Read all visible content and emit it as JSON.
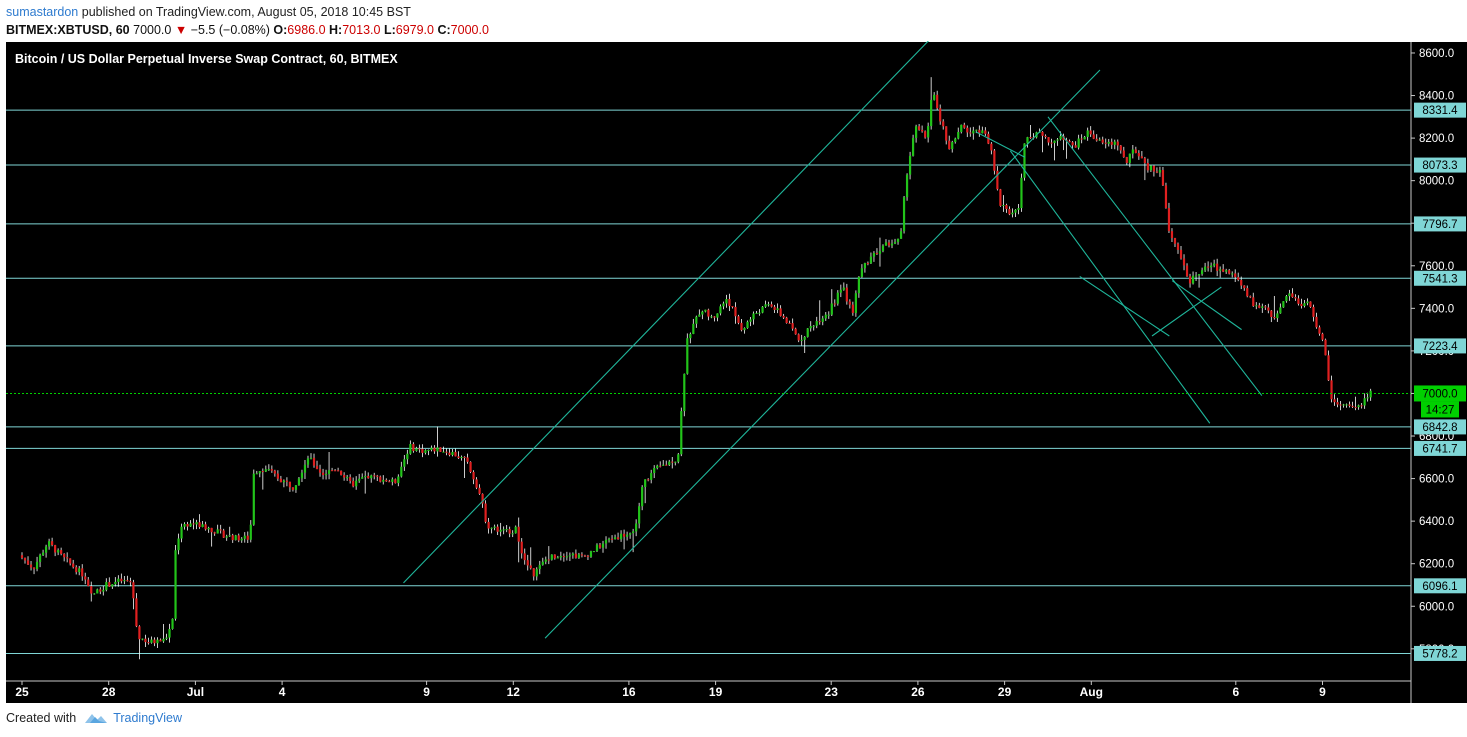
{
  "header": {
    "author": "sumastardon",
    "published": "published on TradingView.com, August 05, 2018 10:45 BST",
    "symbol": "BITMEX:XBTUSD, 60",
    "last": "7000.0",
    "change": "−5.5 (−0.08%)",
    "o_label": "O:",
    "o": "6986.0",
    "h_label": "H:",
    "h": "7013.0",
    "l_label": "L:",
    "l": "6979.0",
    "c_label": "C:",
    "c": "7000.0"
  },
  "footer": {
    "created": "Created with",
    "brand": "TradingView"
  },
  "colors": {
    "background": "#000000",
    "up": "#22c41a",
    "down": "#e02020",
    "wick": "#ffffff",
    "level": "#7fd6d6",
    "channel": "#1fb59a",
    "last_price": "#00d000"
  },
  "chart_data": {
    "type": "candlestick",
    "title": "Bitcoin / US Dollar Perpetual Inverse Swap Contract, 60, BITMEX",
    "timeframe": "60",
    "y_range": [
      5650,
      8650
    ],
    "y_ticks": [
      "5800.0",
      "6000.0",
      "6200.0",
      "6400.0",
      "6600.0",
      "6800.0",
      "7000.0",
      "7200.0",
      "7400.0",
      "7600.0",
      "7800.0",
      "8000.0",
      "8200.0",
      "8400.0",
      "8600.0"
    ],
    "x_tick_labels": [
      {
        "label": "25",
        "day": 0
      },
      {
        "label": "28",
        "day": 3
      },
      {
        "label": "Jul",
        "day": 6
      },
      {
        "label": "4",
        "day": 9
      },
      {
        "label": "9",
        "day": 14
      },
      {
        "label": "12",
        "day": 17
      },
      {
        "label": "16",
        "day": 21
      },
      {
        "label": "19",
        "day": 24
      },
      {
        "label": "23",
        "day": 28
      },
      {
        "label": "26",
        "day": 31
      },
      {
        "label": "29",
        "day": 34
      },
      {
        "label": "Aug",
        "day": 37
      },
      {
        "label": "6",
        "day": 42
      },
      {
        "label": "9",
        "day": 45
      }
    ],
    "x_range_days": [
      -0.3,
      48.6
    ],
    "horizontal_levels": [
      {
        "value": 8331.4,
        "label": "8331.4"
      },
      {
        "value": 8073.3,
        "label": "8073.3"
      },
      {
        "value": 7796.7,
        "label": "7796.7"
      },
      {
        "value": 7541.3,
        "label": "7541.3"
      },
      {
        "value": 7223.4,
        "label": "7223.4"
      },
      {
        "value": 6842.8,
        "label": "6842.8"
      },
      {
        "value": 6741.7,
        "label": "6741.7"
      },
      {
        "value": 6096.1,
        "label": "6096.1"
      },
      {
        "value": 5778.2,
        "label": "5778.2"
      }
    ],
    "last_price": {
      "value": 7000.0,
      "label": "7000.0",
      "countdown": "14:27"
    },
    "trendlines": [
      {
        "x1": 13.2,
        "y1": 6110,
        "x2": 31.6,
        "y2": 8690
      },
      {
        "x1": 18.1,
        "y1": 5850,
        "x2": 37.3,
        "y2": 8520
      },
      {
        "x1": 35.5,
        "y1": 8300,
        "x2": 42.9,
        "y2": 6990
      },
      {
        "x1": 34.2,
        "y1": 8140,
        "x2": 41.1,
        "y2": 6860
      },
      {
        "x1": 36.6,
        "y1": 7550,
        "x2": 39.7,
        "y2": 7270
      },
      {
        "x1": 39.1,
        "y1": 7270,
        "x2": 41.5,
        "y2": 7500
      },
      {
        "x1": 39.8,
        "y1": 7530,
        "x2": 42.2,
        "y2": 7300
      },
      {
        "x1": 33.0,
        "y1": 8230,
        "x2": 34.7,
        "y2": 8110
      }
    ],
    "path_points": [
      [
        0.0,
        6240
      ],
      [
        0.5,
        6180
      ],
      [
        1.0,
        6300
      ],
      [
        1.5,
        6230
      ],
      [
        2.2,
        6150
      ],
      [
        2.5,
        6050
      ],
      [
        3.0,
        6100
      ],
      [
        3.5,
        6120
      ],
      [
        3.9,
        6110
      ],
      [
        4.1,
        5860
      ],
      [
        4.5,
        5830
      ],
      [
        5.0,
        5840
      ],
      [
        5.3,
        5900
      ],
      [
        5.4,
        6250
      ],
      [
        5.6,
        6380
      ],
      [
        6.0,
        6390
      ],
      [
        6.5,
        6370
      ],
      [
        7.0,
        6340
      ],
      [
        7.5,
        6320
      ],
      [
        8.0,
        6320
      ],
      [
        8.1,
        6630
      ],
      [
        8.5,
        6650
      ],
      [
        9.0,
        6600
      ],
      [
        9.5,
        6560
      ],
      [
        10.0,
        6700
      ],
      [
        10.5,
        6620
      ],
      [
        11.0,
        6650
      ],
      [
        11.5,
        6570
      ],
      [
        12.0,
        6610
      ],
      [
        12.5,
        6600
      ],
      [
        13.0,
        6580
      ],
      [
        13.5,
        6750
      ],
      [
        14.0,
        6730
      ],
      [
        14.5,
        6740
      ],
      [
        15.0,
        6720
      ],
      [
        15.5,
        6680
      ],
      [
        15.9,
        6550
      ],
      [
        16.2,
        6380
      ],
      [
        16.7,
        6350
      ],
      [
        17.2,
        6360
      ],
      [
        17.5,
        6210
      ],
      [
        17.8,
        6150
      ],
      [
        18.3,
        6230
      ],
      [
        19.0,
        6250
      ],
      [
        19.5,
        6230
      ],
      [
        20.5,
        6320
      ],
      [
        21.3,
        6350
      ],
      [
        21.6,
        6580
      ],
      [
        22.0,
        6640
      ],
      [
        22.8,
        6700
      ],
      [
        23.1,
        7250
      ],
      [
        23.6,
        7400
      ],
      [
        24.0,
        7350
      ],
      [
        24.5,
        7450
      ],
      [
        25.0,
        7300
      ],
      [
        25.5,
        7380
      ],
      [
        26.0,
        7420
      ],
      [
        26.5,
        7350
      ],
      [
        27.0,
        7250
      ],
      [
        27.5,
        7330
      ],
      [
        28.0,
        7380
      ],
      [
        28.5,
        7500
      ],
      [
        28.9,
        7350
      ],
      [
        29.0,
        7550
      ],
      [
        29.5,
        7650
      ],
      [
        30.0,
        7700
      ],
      [
        30.5,
        7720
      ],
      [
        30.7,
        8020
      ],
      [
        31.0,
        8250
      ],
      [
        31.4,
        8200
      ],
      [
        31.6,
        8420
      ],
      [
        31.9,
        8280
      ],
      [
        32.2,
        8150
      ],
      [
        32.6,
        8250
      ],
      [
        33.0,
        8220
      ],
      [
        33.4,
        8250
      ],
      [
        33.7,
        8100
      ],
      [
        33.9,
        7900
      ],
      [
        34.3,
        7850
      ],
      [
        34.6,
        7870
      ],
      [
        34.8,
        8180
      ],
      [
        35.2,
        8230
      ],
      [
        35.6,
        8180
      ],
      [
        36.0,
        8200
      ],
      [
        36.5,
        8160
      ],
      [
        37.0,
        8230
      ],
      [
        37.5,
        8170
      ],
      [
        38.0,
        8180
      ],
      [
        38.3,
        8080
      ],
      [
        38.6,
        8150
      ],
      [
        39.0,
        8060
      ],
      [
        39.5,
        8050
      ],
      [
        39.8,
        7750
      ],
      [
        40.2,
        7650
      ],
      [
        40.5,
        7520
      ],
      [
        40.9,
        7580
      ],
      [
        41.3,
        7600
      ],
      [
        41.6,
        7580
      ],
      [
        42.0,
        7560
      ],
      [
        42.4,
        7480
      ],
      [
        42.8,
        7400
      ],
      [
        43.0,
        7420
      ],
      [
        43.5,
        7350
      ],
      [
        43.9,
        7480
      ],
      [
        44.3,
        7420
      ],
      [
        44.6,
        7430
      ],
      [
        44.9,
        7320
      ],
      [
        45.2,
        7200
      ],
      [
        45.4,
        6960
      ],
      [
        45.8,
        6940
      ],
      [
        46.3,
        6930
      ],
      [
        46.7,
        7000
      ]
    ]
  }
}
